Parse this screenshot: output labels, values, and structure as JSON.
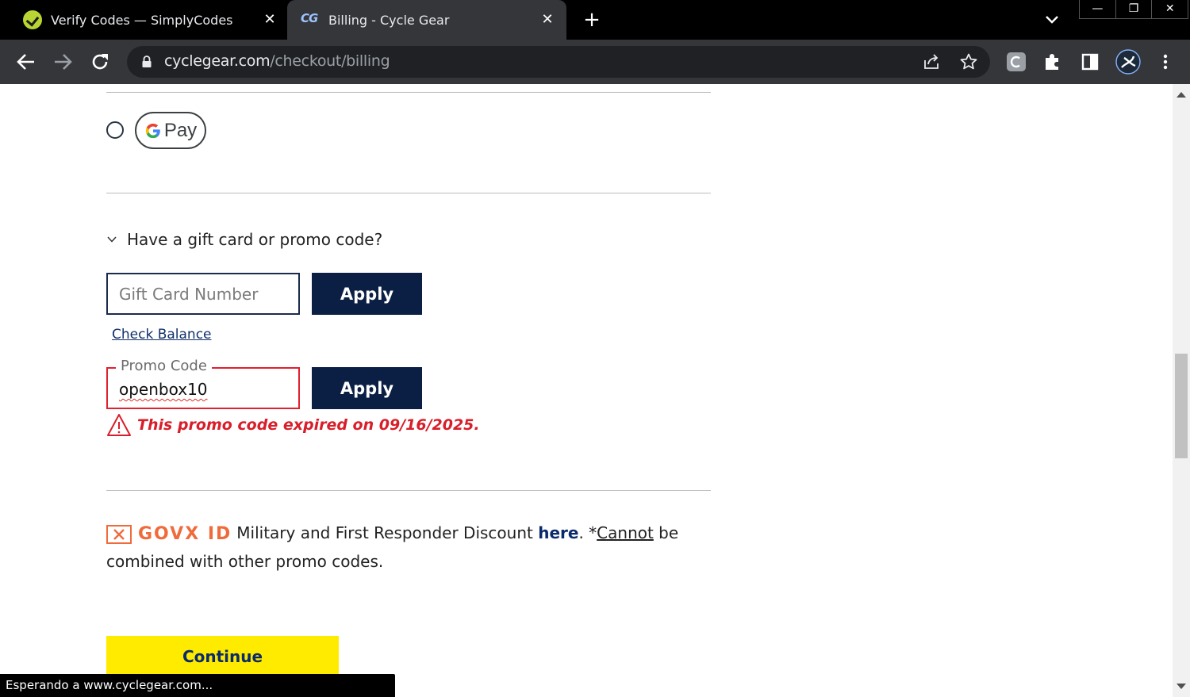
{
  "browser": {
    "tabs": [
      {
        "title": "Verify Codes — SimplyCodes",
        "favicon": "simplycodes-check-icon",
        "active": false
      },
      {
        "title": "Billing - Cycle Gear",
        "favicon": "cyclegear-cg-icon",
        "favicon_text": "CG",
        "active": true
      }
    ],
    "close_glyph": "✕",
    "new_tab_glyph": "+",
    "window_buttons": {
      "minimize": "—",
      "restore": "❐",
      "close": "✕"
    },
    "url_host": "cyclegear.com",
    "url_path": "/checkout/billing"
  },
  "payment": {
    "gpay_label": "Pay"
  },
  "promo": {
    "toggle_label": "Have a gift card or promo code?",
    "gift_placeholder": "Gift Card Number",
    "apply_label": "Apply",
    "check_balance": "Check Balance",
    "promo_legend": "Promo Code",
    "promo_value": "openbox10",
    "error": "This promo code expired on 09/16/2025."
  },
  "govx": {
    "logo_text": "GOVX ID",
    "text_1": "Military and First Responder Discount ",
    "link": "here",
    "text_2": ". *",
    "cannot": "Cannot",
    "text_3": " be combined with other promo codes."
  },
  "continue_label": "Continue",
  "status_text": "Esperando a www.cyclegear.com...",
  "colors": {
    "navy": "#0b1f44",
    "error_red": "#d81e2a",
    "continue_yellow": "#ffeb00",
    "govx_orange": "#f06b3c"
  }
}
